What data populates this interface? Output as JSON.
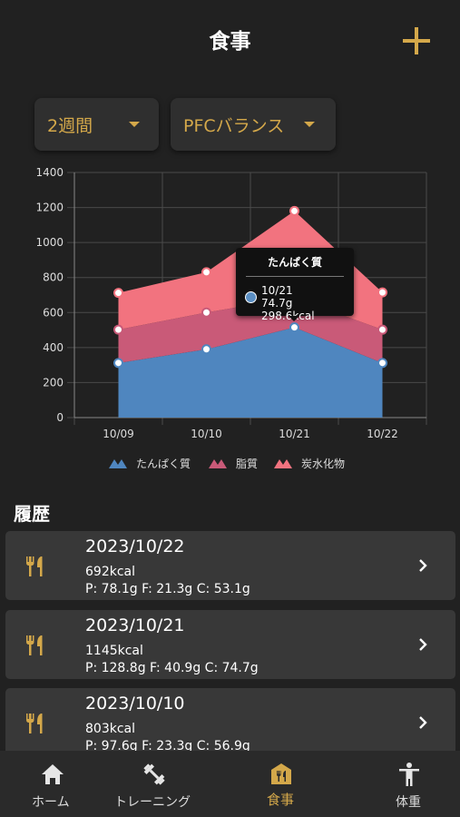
{
  "header": {
    "title": "食事"
  },
  "filters": {
    "period": "2週間",
    "mode": "PFCバランス"
  },
  "colors": {
    "accent": "#d4a84a",
    "protein": "#4f86bf",
    "fat": "#c95a78",
    "carb": "#f2737f"
  },
  "chart_data": {
    "type": "area",
    "stacked": true,
    "categories": [
      "10/09",
      "10/10",
      "10/21",
      "10/22"
    ],
    "series": [
      {
        "name": "たんぱく質",
        "values": [
          312,
          390,
          515,
          312
        ]
      },
      {
        "name": "脂質",
        "values": [
          190,
          210,
          170,
          190
        ]
      },
      {
        "name": "炭水化物",
        "values": [
          210,
          230,
          495,
          213
        ]
      }
    ],
    "ylim": [
      0,
      1400
    ],
    "yticks": [
      "0",
      "200",
      "400",
      "600",
      "800",
      "1000",
      "1200",
      "1400"
    ],
    "grid": true,
    "legend": "bottom",
    "tooltip": {
      "title": "たんぱく質",
      "date": "10/21",
      "value": "74.7g 298.6kcal"
    }
  },
  "history": {
    "title": "履歴",
    "items": [
      {
        "date": "2023/10/22",
        "kcal": "692kcal",
        "pfc": "P: 78.1g F: 21.3g C: 53.1g"
      },
      {
        "date": "2023/10/21",
        "kcal": "1145kcal",
        "pfc": "P: 128.8g F: 40.9g C: 74.7g"
      },
      {
        "date": "2023/10/10",
        "kcal": "803kcal",
        "pfc": "P: 97.6g F: 23.3g C: 56.9g"
      }
    ]
  },
  "nav": {
    "home": "ホーム",
    "training": "トレーニング",
    "meal": "食事",
    "weight": "体重"
  }
}
